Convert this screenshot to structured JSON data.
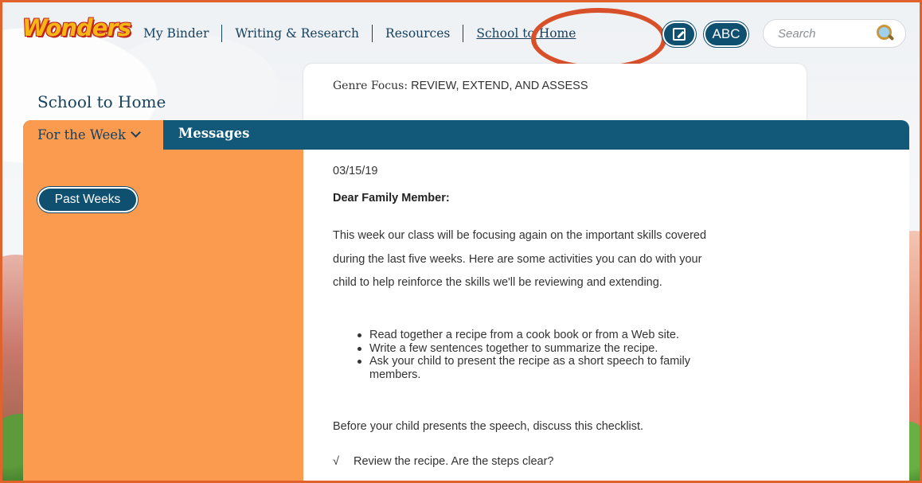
{
  "header": {
    "logo_text": "Wonders",
    "nav": [
      {
        "label": "My Binder"
      },
      {
        "label": "Writing & Research"
      },
      {
        "label": "Resources"
      },
      {
        "label": "School to Home",
        "active": true
      }
    ],
    "abc_label": "ABC",
    "search_placeholder": "Search"
  },
  "page": {
    "title": "School to Home",
    "genre_label": "Genre Focus:",
    "genre_value": "REVIEW, EXTEND, AND ASSESS"
  },
  "tabs": {
    "week": "For the Week",
    "messages": "Messages"
  },
  "sidebar": {
    "past_weeks": "Past Weeks"
  },
  "message": {
    "date": "03/15/19",
    "greeting": "Dear Family Member:",
    "intro": "This week our class will be focusing again on the important skills covered during the last five weeks. Here are some activities you can do with your child to help reinforce the skills we'll be reviewing and extending.",
    "activities": [
      "Read together a recipe from a cook book or from a Web site.",
      "Write a few sentences together to summarize the recipe.",
      "Ask your child to present the recipe as a short speech to family members."
    ],
    "before_checklist": "Before your child presents the speech, discuss this checklist.",
    "checklist": [
      {
        "mark": "√",
        "text": "Review the recipe. Are the steps clear?"
      }
    ]
  },
  "colors": {
    "nav_blue": "#16415f",
    "tab_bar": "#125879",
    "sidebar_orange": "#fb9b4f",
    "highlight_circle": "#d7502a",
    "frame": "#e1622a"
  },
  "icons": {
    "edit": "edit-icon",
    "search": "search-icon",
    "chevron": "chevron-down-icon"
  }
}
